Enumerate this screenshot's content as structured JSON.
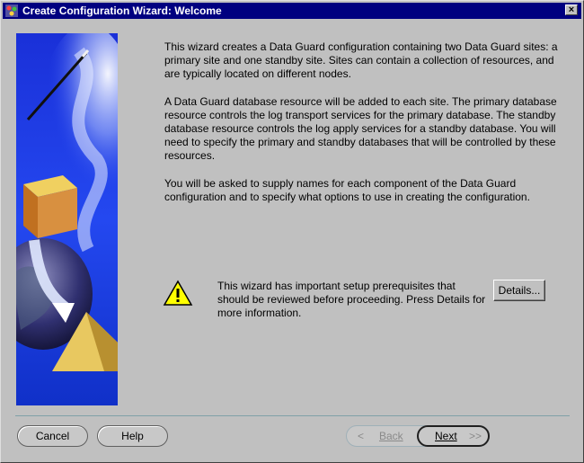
{
  "window": {
    "title": "Create Configuration Wizard: Welcome",
    "close_label": "×",
    "accent_color": "#000080"
  },
  "intro": {
    "paragraph1": "This wizard creates a Data Guard configuration containing two Data Guard sites: a primary site and one standby site. Sites can contain a collection of resources, and are typically located on different nodes.",
    "paragraph2": "A Data Guard database resource will be added to each site. The primary database resource controls the log transport services for the primary database. The standby database resource controls the log apply services for a standby database. You will need to specify the primary and standby databases that will be controlled by these resources.",
    "paragraph3": "You will be asked to supply names for each component of the Data Guard configuration and to specify what options to use in creating the configuration."
  },
  "warning": {
    "icon": "warning-icon",
    "text": "This wizard has important setup prerequisites that should be reviewed before proceeding. Press Details for more information.",
    "details_label": "Details..."
  },
  "footer": {
    "cancel_label": "Cancel",
    "help_label": "Help",
    "back_label": "Back",
    "back_chevron": "<",
    "next_label": "Next",
    "next_chevron": ">>"
  }
}
